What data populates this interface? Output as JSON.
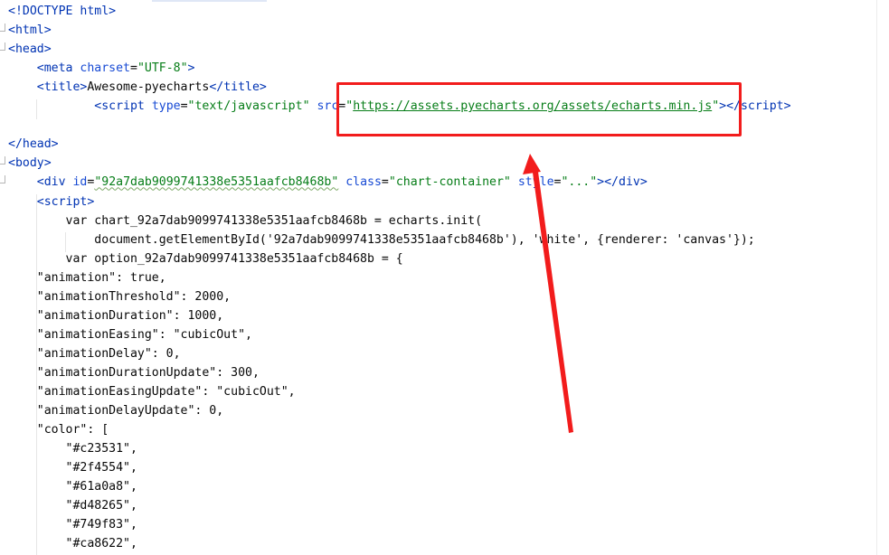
{
  "editor": {
    "lines": [
      [
        {
          "t": "<!DOCTYPE ",
          "c": "tag"
        },
        {
          "t": "html",
          "c": "tag"
        },
        {
          "t": ">",
          "c": "tag"
        }
      ],
      [
        {
          "t": "<html>",
          "c": "tag"
        }
      ],
      [
        {
          "t": "<head>",
          "c": "tag"
        }
      ],
      [
        {
          "t": "    "
        },
        {
          "t": "<meta ",
          "c": "tag"
        },
        {
          "t": "charset",
          "c": "attr"
        },
        {
          "t": "=",
          "c": "plain"
        },
        {
          "t": "\"UTF-8\"",
          "c": "str"
        },
        {
          "t": ">",
          "c": "tag"
        }
      ],
      [
        {
          "t": "    "
        },
        {
          "t": "<title>",
          "c": "tag"
        },
        {
          "t": "Awesome-pyecharts",
          "c": "plain"
        },
        {
          "t": "</title>",
          "c": "tag"
        }
      ],
      [
        {
          "t": "            "
        },
        {
          "t": "<script ",
          "c": "tag"
        },
        {
          "t": "type",
          "c": "attr"
        },
        {
          "t": "=",
          "c": "plain"
        },
        {
          "t": "\"text/javascript\"",
          "c": "str"
        },
        {
          "t": " "
        },
        {
          "t": "src",
          "c": "attr"
        },
        {
          "t": "=",
          "c": "plain"
        },
        {
          "t": "\"",
          "c": "str"
        },
        {
          "t": "https://assets.pyecharts.org/assets/echarts.min.js",
          "c": "url"
        },
        {
          "t": "\"",
          "c": "str"
        },
        {
          "t": "></",
          "c": "tag"
        },
        {
          "t": "script",
          "c": "tag"
        },
        {
          "t": ">",
          "c": "tag"
        }
      ],
      [],
      [
        {
          "t": "</head>",
          "c": "tag"
        }
      ],
      [
        {
          "t": "<body>",
          "c": "tag"
        }
      ],
      [
        {
          "t": "    "
        },
        {
          "t": "<div ",
          "c": "tag"
        },
        {
          "t": "id",
          "c": "attr"
        },
        {
          "t": "=",
          "c": "plain"
        },
        {
          "t": "\"92a7dab9099741338e5351aafcb8468b\"",
          "c": "str squig"
        },
        {
          "t": " "
        },
        {
          "t": "class",
          "c": "attr"
        },
        {
          "t": "=",
          "c": "plain"
        },
        {
          "t": "\"chart-container\"",
          "c": "str"
        },
        {
          "t": " "
        },
        {
          "t": "style",
          "c": "attr"
        },
        {
          "t": "=",
          "c": "plain"
        },
        {
          "t": "\"...\"",
          "c": "str"
        },
        {
          "t": "></",
          "c": "tag"
        },
        {
          "t": "div",
          "c": "tag"
        },
        {
          "t": ">",
          "c": "tag"
        }
      ],
      [
        {
          "t": "    "
        },
        {
          "t": "<script>",
          "c": "tag"
        }
      ],
      [
        {
          "t": "        var chart_92a7dab9099741338e5351aafcb8468b = echarts.init(",
          "c": "plain"
        }
      ],
      [
        {
          "t": "            document.getElementById('92a7dab9099741338e5351aafcb8468b'), 'white', {renderer: 'canvas'});",
          "c": "plain"
        }
      ],
      [
        {
          "t": "        var option_92a7dab9099741338e5351aafcb8468b = {",
          "c": "plain"
        }
      ],
      [
        {
          "t": "    \"animation\": true,",
          "c": "plain"
        }
      ],
      [
        {
          "t": "    \"animationThreshold\": 2000,",
          "c": "plain"
        }
      ],
      [
        {
          "t": "    \"animationDuration\": 1000,",
          "c": "plain"
        }
      ],
      [
        {
          "t": "    \"animationEasing\": \"cubicOut\",",
          "c": "plain"
        }
      ],
      [
        {
          "t": "    \"animationDelay\": 0,",
          "c": "plain"
        }
      ],
      [
        {
          "t": "    \"animationDurationUpdate\": 300,",
          "c": "plain"
        }
      ],
      [
        {
          "t": "    \"animationEasingUpdate\": \"cubicOut\",",
          "c": "plain"
        }
      ],
      [
        {
          "t": "    \"animationDelayUpdate\": 0,",
          "c": "plain"
        }
      ],
      [
        {
          "t": "    \"color\": [",
          "c": "plain"
        }
      ],
      [
        {
          "t": "        \"#c23531\",",
          "c": "plain"
        }
      ],
      [
        {
          "t": "        \"#2f4554\",",
          "c": "plain"
        }
      ],
      [
        {
          "t": "        \"#61a0a8\",",
          "c": "plain"
        }
      ],
      [
        {
          "t": "        \"#d48265\",",
          "c": "plain"
        }
      ],
      [
        {
          "t": "        \"#749f83\",",
          "c": "plain"
        }
      ],
      [
        {
          "t": "        \"#ca8622\",",
          "c": "plain"
        }
      ]
    ]
  },
  "annotation": {
    "highlight_color": "#f21c1c",
    "arrow_color": "#f21c1c"
  },
  "theme": {
    "tag_color": "#0033b3",
    "attr_color": "#174ad4",
    "string_color": "#067d17",
    "text_color": "#080808",
    "background": "#ffffff"
  }
}
